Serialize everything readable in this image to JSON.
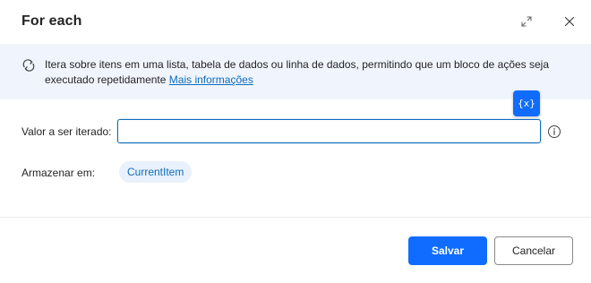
{
  "dialog": {
    "title": "For each",
    "expand_icon": "expand-icon",
    "close_icon": "close-icon"
  },
  "banner": {
    "icon": "loop-icon",
    "text": "Itera sobre itens em uma lista, tabela de dados ou linha de dados, permitindo que um bloco de ações seja executado repetidamente",
    "link": "Mais informações"
  },
  "form": {
    "variable_button": "{x}",
    "valor_label": "Valor a ser iterado:",
    "valor_value": "",
    "info_icon": "info-icon",
    "armazenar_label": "Armazenar em:",
    "armazenar_variable": "CurrentItem"
  },
  "footer": {
    "save_label": "Salvar",
    "cancel_label": "Cancelar"
  },
  "colors": {
    "accent": "#0f6cff",
    "link": "#0f6cbd",
    "banner_bg": "#f0f5fd",
    "chip_bg": "#e8f1fc"
  }
}
